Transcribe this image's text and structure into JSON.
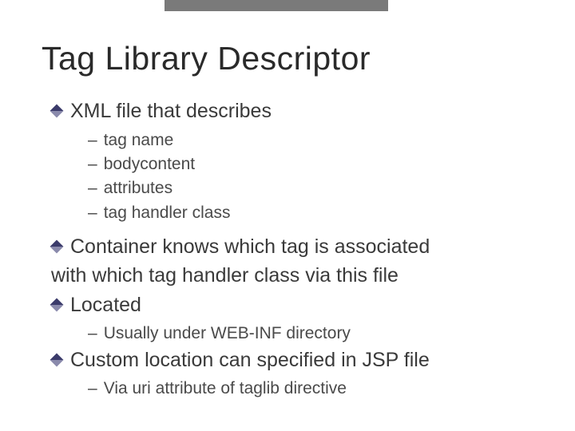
{
  "title": "Tag Library Descriptor",
  "bullets": {
    "b1": {
      "text": "XML file that describes"
    },
    "b1_sub": [
      "tag name",
      "bodycontent",
      "attributes",
      "tag handler class"
    ],
    "b2_line1": " Container knows which tag is associated",
    "b2_line2": "with which tag handler class via this file",
    "b3": {
      "text": " Located"
    },
    "b3_sub": [
      "Usually under WEB-INF directory"
    ],
    "b4": {
      "text": " Custom location can specified in JSP file"
    },
    "b4_sub": [
      "Via uri attribute of taglib directive"
    ]
  },
  "dash": "–"
}
